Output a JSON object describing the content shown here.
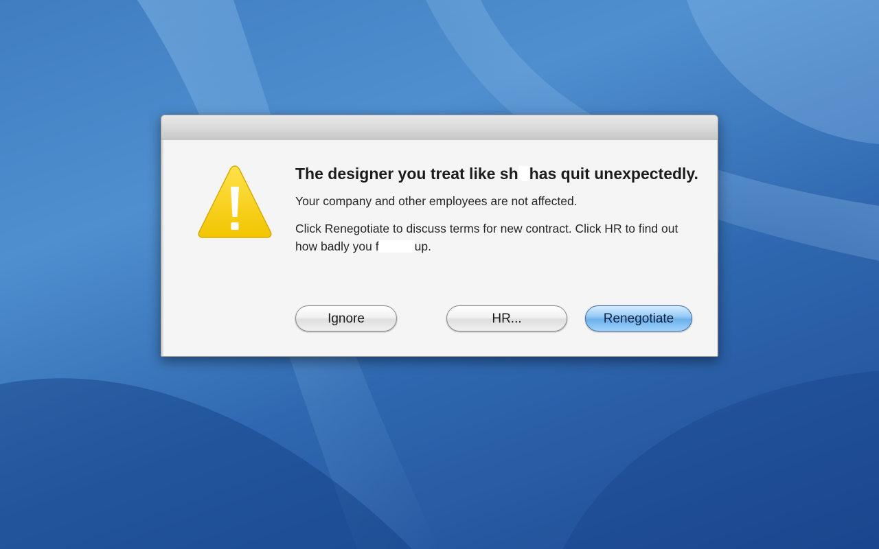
{
  "dialog": {
    "headline_part1": "The designer you treat like sh",
    "headline_part2": "has quit unexpectedly.",
    "line1": "Your company and other employees are not affected.",
    "line2_part1": "Click Renegotiate to discuss terms for new contract. Click HR to find out how badly you f",
    "line2_part2": "up.",
    "icon": "warning-triangle-icon",
    "icon_color": "#f5cc00"
  },
  "buttons": {
    "ignore": "Ignore",
    "hr": "HR...",
    "renegotiate": "Renegotiate"
  },
  "colors": {
    "desktop": "#3f7dc0",
    "default_button": "#6eb0ea"
  }
}
